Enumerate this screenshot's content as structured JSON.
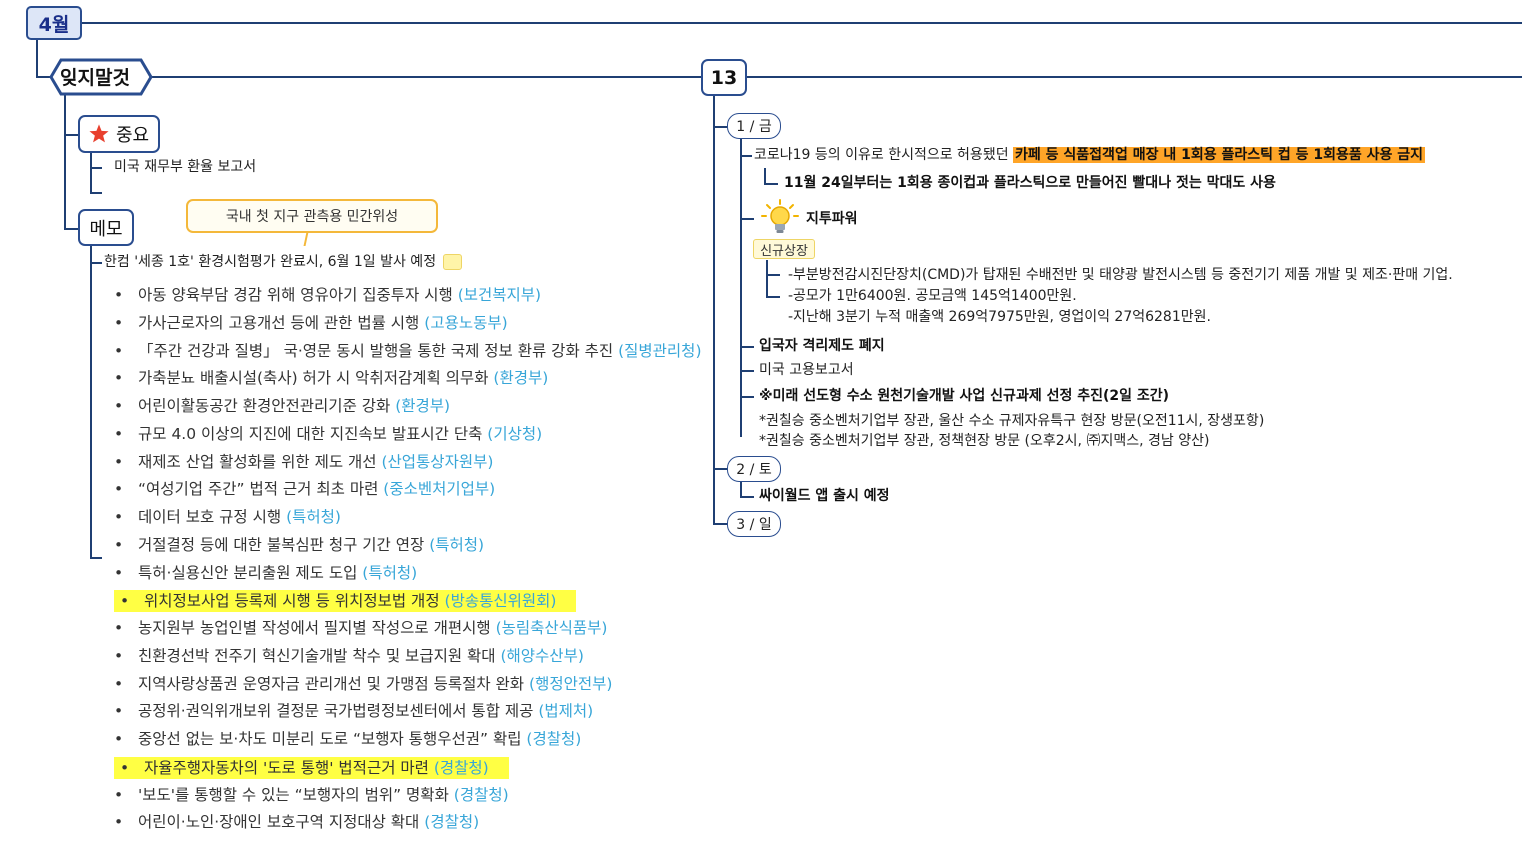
{
  "month": "4월",
  "remember": {
    "title": "잊지말것",
    "important": {
      "icon": "star-icon",
      "label": "중요",
      "items": [
        "미국 재무부 환율 보고서",
        ""
      ]
    },
    "memo": {
      "label": "메모",
      "callout": "국내 첫 지구 관측용 민간위성",
      "first": "한컴 '세종 1호'  환경시험평가  완료시, 6월 1일 발사 예정",
      "bullets": [
        {
          "text": "아동 양육부담 경감 위해 영유아기 집중투자 시행",
          "agency": "(보건복지부)",
          "hl": false
        },
        {
          "text": "가사근로자의 고용개선 등에 관한 법률 시행",
          "agency": "(고용노동부)",
          "hl": false
        },
        {
          "text": "「주간 건강과 질병」 국·영문 동시 발행을 통한 국제 정보 환류 강화 추진",
          "agency": "(질병관리청)",
          "hl": false
        },
        {
          "text": "가축분뇨 배출시설(축사) 허가 시 악취저감계획 의무화",
          "agency": "(환경부)",
          "hl": false
        },
        {
          "text": "어린이활동공간 환경안전관리기준 강화",
          "agency": "(환경부)",
          "hl": false
        },
        {
          "text": "규모 4.0 이상의 지진에 대한 지진속보 발표시간 단축",
          "agency": "(기상청)",
          "hl": false
        },
        {
          "text": "재제조 산업 활성화를 위한 제도 개선",
          "agency": "(산업통상자원부)",
          "hl": false
        },
        {
          "text": "“여성기업 주간” 법적 근거 최초 마련",
          "agency": "(중소벤처기업부)",
          "hl": false
        },
        {
          "text": "데이터 보호 규정 시행",
          "agency": "(특허청)",
          "hl": false
        },
        {
          "text": "거절결정 등에 대한 불복심판 청구 기간 연장",
          "agency": "(특허청)",
          "hl": false
        },
        {
          "text": "특허·실용신안 분리출원 제도 도입",
          "agency": "(특허청)",
          "hl": false
        },
        {
          "text": "위치정보사업 등록제 시행 등 위치정보법 개정",
          "agency": "(방송통신위원회)",
          "hl": true
        },
        {
          "text": "농지원부 농업인별 작성에서 필지별 작성으로 개편시행",
          "agency": "(농림축산식품부)",
          "hl": false
        },
        {
          "text": "친환경선박 전주기 혁신기술개발 착수 및 보급지원 확대",
          "agency": "(해양수산부)",
          "hl": false
        },
        {
          "text": "지역사랑상품권 운영자금 관리개선 및 가맹점 등록절차 완화",
          "agency": "(행정안전부)",
          "hl": false
        },
        {
          "text": "공정위·권익위개보위 결정문 국가법령정보센터에서 통합 제공",
          "agency": "(법제처)",
          "hl": false
        },
        {
          "text": "중앙선 없는 보·차도 미분리 도로 “보행자 통행우선권” 확립",
          "agency": "(경찰청)",
          "hl": false
        },
        {
          "text": "자율주행자동차의 '도로 통행' 법적근거 마련",
          "agency": "(경찰청)",
          "hl": true
        },
        {
          "text": "'보도'를 통행할 수 있는 “보행자의 범위” 명확화",
          "agency": "(경찰청)",
          "hl": false
        },
        {
          "text": "어린이·노인·장애인 보호구역 지정대상 확대",
          "agency": "(경찰청)",
          "hl": false
        }
      ]
    }
  },
  "week": {
    "number": "13",
    "day1": {
      "label": "1 / 금",
      "corona_prefix": "코로나19 등의 이유로 한시적으로 허용됐던 ",
      "corona_highlight": "카페 등 식품접객업 매장 내 1회용 플라스틱 컵 등 1회용품 사용 금지",
      "corona_sub": "11월 24일부터는 1회용 종이컵과 플라스틱으로 만들어진 빨대나 젓는 막대도 사용",
      "company": "지투파워",
      "company_icon": "lightbulb-icon",
      "tag": "신규상장",
      "company_details": [
        "-부분방전감시진단장치(CMD)가 탑재된 수배전반 및 태양광 발전시스템 등 중전기기 제품 개발 및 제조·판매 기업.",
        "-공모가 1만6400원.  공모금액  145억1400만원.",
        "-지난해 3분기 누적 매출액 269억7975만원, 영업이익 27억6281만원."
      ],
      "entry_policy": "입국자 격리제도 폐지",
      "us_report": "미국 고용보고서",
      "hydrogen": "※미래 선도형 수소 원천기술개발 사업 신규과제 선정 추진(2일 조간)",
      "schedule": [
        "*권칠승 중소벤처기업부 장관, 울산 수소 규제자유특구 현장 방문(오전11시, 장생포항)",
        "*권칠승 중소벤처기업부 장관, 정책현장 방문 (오후2시, ㈜지맥스, 경남 양산)"
      ]
    },
    "day2": {
      "label": "2 / 토",
      "item": "싸이월드 앱 출시 예정"
    },
    "day3": {
      "label": "3 / 일"
    }
  },
  "colors": {
    "node_border": "#2a4d8f",
    "agency": "#38a6d8",
    "highlight": "#ffff44",
    "orange": "#ffa528"
  }
}
